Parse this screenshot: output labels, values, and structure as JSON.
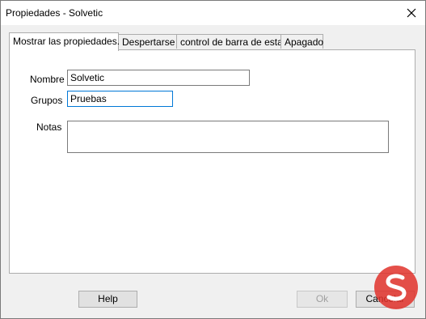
{
  "window": {
    "title": "Propiedades - Solvetic"
  },
  "tabs": [
    {
      "label": "Mostrar las propiedades.",
      "active": true
    },
    {
      "label": "Despertarse",
      "active": false
    },
    {
      "label": "control de barra de estado",
      "active": false
    },
    {
      "label": "Apagado",
      "active": false
    }
  ],
  "form": {
    "nombre_label": "Nombre",
    "nombre_value": "Solvetic",
    "grupos_label": "Grupos",
    "grupos_value": "Pruebas",
    "notas_label": "Notas",
    "notas_value": ""
  },
  "buttons": {
    "help": "Help",
    "ok": "Ok",
    "cancel": "Cancelar"
  },
  "colors": {
    "focus_border": "#0078d7",
    "logo_red": "#e0312a"
  }
}
